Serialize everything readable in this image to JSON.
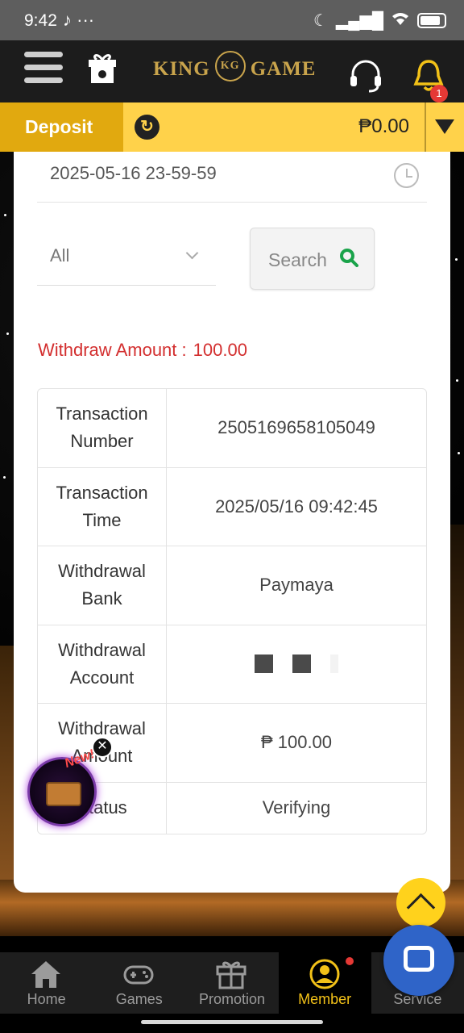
{
  "status_bar": {
    "time": "9:42",
    "app_icons": "♪ ···"
  },
  "header": {
    "logo_left": "KING",
    "logo_mono": "KG",
    "logo_right": "GAME",
    "notification_count": "1"
  },
  "deposit_bar": {
    "deposit_label": "Deposit",
    "balance": "₱0.00"
  },
  "filter": {
    "end_date": "2025-05-16 23-59-59",
    "type_selected": "All",
    "search_label": "Search"
  },
  "withdraw": {
    "amount_label": "Withdraw Amount :",
    "amount_value": "100.00"
  },
  "details": [
    {
      "label": "Transaction Number",
      "value": "2505169658105049"
    },
    {
      "label": "Transaction Time",
      "value": "2025/05/16 09:42:45"
    },
    {
      "label": "Withdrawal Bank",
      "value": "Paymaya"
    },
    {
      "label": "Withdrawal Account",
      "value": ""
    },
    {
      "label": "Withdrawal Amount",
      "value": "₱ 100.00"
    },
    {
      "label": "Status",
      "value": "Verifying"
    }
  ],
  "promo": {
    "badge": "New!",
    "close": "✕"
  },
  "bottom_nav": [
    {
      "label": "Home",
      "icon": "home-icon"
    },
    {
      "label": "Games",
      "icon": "gamepad-icon"
    },
    {
      "label": "Promotion",
      "icon": "gift-icon"
    },
    {
      "label": "Member",
      "icon": "member-icon"
    },
    {
      "label": "Service",
      "icon": "chat-icon"
    }
  ],
  "colors": {
    "accent_yellow": "#ffd24a",
    "deposit_orange": "#e1a90f",
    "warning_red": "#d32f2f",
    "active_nav": "#f2c118",
    "search_green": "#1aa34a"
  }
}
